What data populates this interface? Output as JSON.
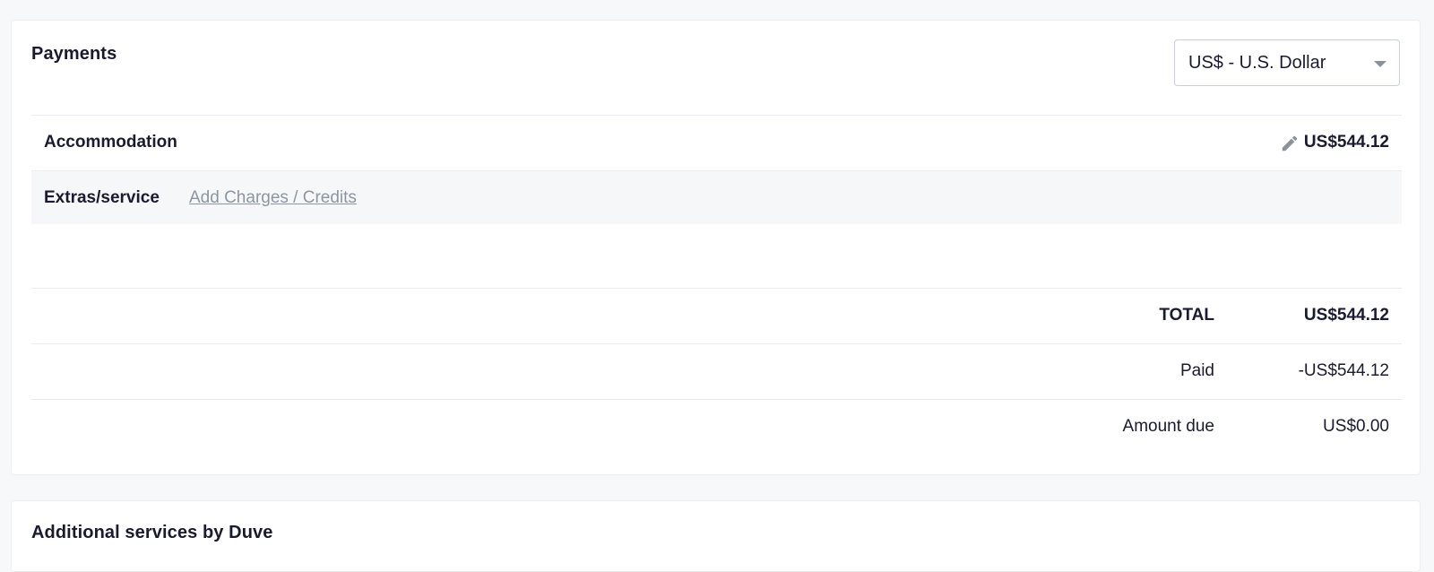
{
  "payments": {
    "title": "Payments",
    "currency_select": {
      "value": "US$ - U.S. Dollar"
    },
    "accommodation": {
      "label": "Accommodation",
      "amount": "US$544.12",
      "edit_icon": "pencil-icon"
    },
    "extras": {
      "label": "Extras/service",
      "link": "Add Charges / Credits"
    },
    "totals": {
      "total_label": "TOTAL",
      "total_value": "US$544.12",
      "paid_label": "Paid",
      "paid_value": "-US$544.12",
      "due_label": "Amount due",
      "due_value": "US$0.00"
    }
  },
  "additional": {
    "title": "Additional services by Duve"
  },
  "colors": {
    "text": "#1b1a30",
    "link": "#8c96a3",
    "border": "#e8ebef",
    "page_bg": "#f7f8fa"
  }
}
